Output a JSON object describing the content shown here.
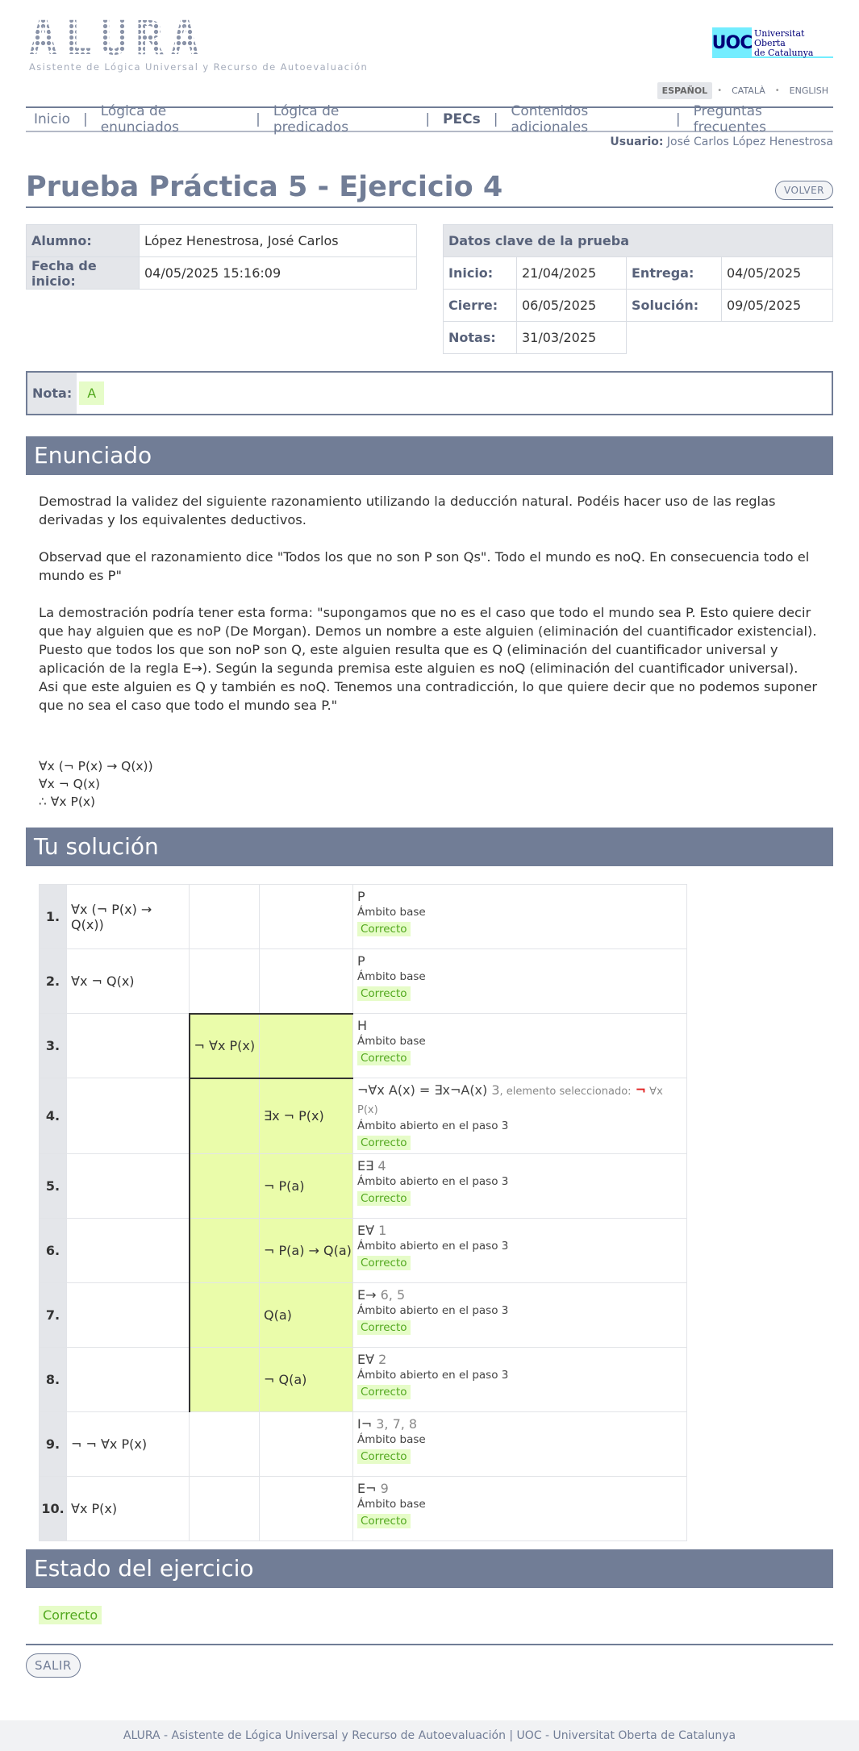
{
  "header": {
    "logo_word": "ALURA",
    "logo_subtitle": "Asistente de Lógica Universal y Recurso de Autoevaluación",
    "uoc_mark": "UOC",
    "uoc_name_line1": "Universitat Oberta",
    "uoc_name_line2": "de Catalunya"
  },
  "languages": [
    "ESPAÑOL",
    "CATALÀ",
    "ENGLISH"
  ],
  "nav": [
    "Inicio",
    "Lógica de enunciados",
    "Lógica de predicados",
    "PECs",
    "Contenidos adicionales",
    "Preguntas frecuentes"
  ],
  "user": {
    "label": "Usuario:",
    "name": "José Carlos López Henestrosa"
  },
  "title": "Prueba Práctica 5 - Ejercicio 4",
  "back_button": "VOLVER",
  "student": {
    "alumno_label": "Alumno:",
    "alumno": "López Henestrosa, José Carlos",
    "fecha_label": "Fecha de inicio:",
    "fecha": "04/05/2025 15:16:09"
  },
  "key_data": {
    "header": "Datos clave de la prueba",
    "inicio_label": "Inicio:",
    "inicio": "21/04/2025",
    "entrega_label": "Entrega:",
    "entrega": "04/05/2025",
    "cierre_label": "Cierre:",
    "cierre": "06/05/2025",
    "solucion_label": "Solución:",
    "solucion": "09/05/2025",
    "notas_label": "Notas:",
    "notas": "31/03/2025"
  },
  "grade": {
    "label": "Nota:",
    "value": "A"
  },
  "enunciado": {
    "heading": "Enunciado",
    "p1": "Demostrad la validez del siguiente razonamiento utilizando la deducción natural. Podéis hacer uso de las reglas derivadas y los equivalentes deductivos.",
    "p2": "Observad que el razonamiento dice \"Todos los que no son P son Qs\". Todo el mundo es noQ. En consecuencia todo el mundo es P\"",
    "p3": "La demostración podría tener esta forma: \"supongamos que no es el caso que todo el mundo sea P. Esto quiere decir que hay alguien que es noP (De Morgan). Demos un nombre a este alguien (eliminación del cuantificador existencial). Puesto que todos los que son noP son Q, este alguien resulta que es Q (eliminación del cuantificador universal y aplicación de la regla E→). Según la segunda premisa este alguien es noQ (eliminación del cuantificador universal). Asi que este alguien es Q y también es noQ. Tenemos una contradicción, lo que quiere decir que no podemos suponer que no sea el caso que todo el mundo sea P.\"",
    "premise1": "∀x (¬ P(x) → Q(x))",
    "premise2": "∀x ¬ Q(x)",
    "conclusion": "∴ ∀x P(x)"
  },
  "solution": {
    "heading": "Tu solución",
    "steps": [
      {
        "n": "1.",
        "f": "∀x (¬ P(x) → Q(x))",
        "rule": "P",
        "ref": "",
        "scope": "Ámbito base",
        "status": "Correcto"
      },
      {
        "n": "2.",
        "f": "∀x ¬ Q(x)",
        "rule": "P",
        "ref": "",
        "scope": "Ámbito base",
        "status": "Correcto"
      },
      {
        "n": "3.",
        "f": "¬ ∀x P(x)",
        "rule": "H",
        "ref": "",
        "scope": "Ámbito base",
        "status": "Correcto"
      },
      {
        "n": "4.",
        "f": "∃x ¬ P(x)",
        "rule": "¬∀x A(x) = ∃x¬A(x)",
        "ref": "3",
        "extra": ", elemento seleccionado:",
        "extra_sym": "¬",
        "extra_f": " ∀x P(x)",
        "scope": "Ámbito abierto en el paso 3",
        "status": "Correcto"
      },
      {
        "n": "5.",
        "f": "¬ P(a)",
        "rule": "E∃",
        "ref": "4",
        "scope": "Ámbito abierto en el paso 3",
        "status": "Correcto"
      },
      {
        "n": "6.",
        "f": "¬ P(a) → Q(a)",
        "rule": "E∀",
        "ref": "1",
        "scope": "Ámbito abierto en el paso 3",
        "status": "Correcto"
      },
      {
        "n": "7.",
        "f": "Q(a)",
        "rule": "E→",
        "ref": "6, 5",
        "scope": "Ámbito abierto en el paso 3",
        "status": "Correcto"
      },
      {
        "n": "8.",
        "f": "¬ Q(a)",
        "rule": "E∀",
        "ref": "2",
        "scope": "Ámbito abierto en el paso 3",
        "status": "Correcto"
      },
      {
        "n": "9.",
        "f": "¬ ¬ ∀x P(x)",
        "rule": "I¬",
        "ref": "3, 7, 8",
        "scope": "Ámbito base",
        "status": "Correcto"
      },
      {
        "n": "10.",
        "f": "∀x P(x)",
        "rule": "E¬",
        "ref": "9",
        "scope": "Ámbito base",
        "status": "Correcto"
      }
    ]
  },
  "estado": {
    "heading": "Estado del ejercicio",
    "value": "Correcto"
  },
  "exit_button": "SALIR",
  "footer": "ALURA - Asistente de Lógica Universal y Recurso de Autoevaluación | UOC - Universitat Oberta de Catalunya",
  "colors": {
    "primary": "#717d96",
    "highlight": "#eafcaa",
    "ok_bg": "#e6fcc8",
    "ok_text": "#52a81e",
    "uoc_cyan": "#73edff"
  }
}
